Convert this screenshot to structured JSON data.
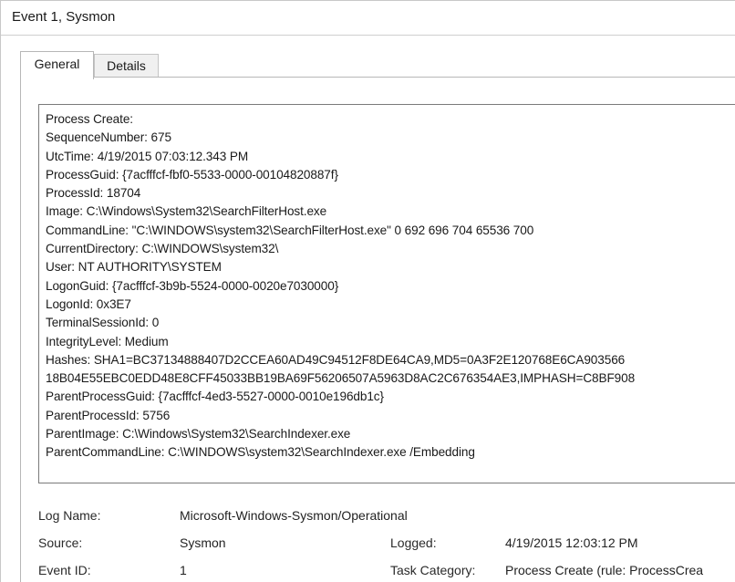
{
  "window": {
    "title": "Event 1, Sysmon"
  },
  "tabs": [
    {
      "label": "General",
      "selected": true
    },
    {
      "label": "Details",
      "selected": false
    }
  ],
  "description_lines": [
    "Process Create:",
    "SequenceNumber: 675",
    "UtcTime: 4/19/2015 07:03:12.343 PM",
    "ProcessGuid: {7acfffcf-fbf0-5533-0000-00104820887f}",
    "ProcessId: 18704",
    "Image: C:\\Windows\\System32\\SearchFilterHost.exe",
    "CommandLine: \"C:\\WINDOWS\\system32\\SearchFilterHost.exe\" 0 692 696 704 65536 700",
    "CurrentDirectory: C:\\WINDOWS\\system32\\",
    "User: NT AUTHORITY\\SYSTEM",
    "LogonGuid: {7acfffcf-3b9b-5524-0000-0020e7030000}",
    "LogonId: 0x3E7",
    "TerminalSessionId: 0",
    "IntegrityLevel: Medium",
    "Hashes: SHA1=BC37134888407D2CCEA60AD49C94512F8DE64CA9,MD5=0A3F2E120768E6CA903566",
    "18B04E55EBC0EDD48E8CFF45033BB19BA69F56206507A5963D8AC2C676354AE3,IMPHASH=C8BF908",
    "ParentProcessGuid: {7acfffcf-4ed3-5527-0000-0010e196db1c}",
    "ParentProcessId: 5756",
    "ParentImage: C:\\Windows\\System32\\SearchIndexer.exe",
    "ParentCommandLine: C:\\WINDOWS\\system32\\SearchIndexer.exe /Embedding"
  ],
  "properties": {
    "log_name": {
      "label": "Log Name:",
      "value": "Microsoft-Windows-Sysmon/Operational"
    },
    "source": {
      "label": "Source:",
      "value": "Sysmon"
    },
    "logged": {
      "label": "Logged:",
      "value": "4/19/2015 12:03:12 PM"
    },
    "event_id": {
      "label": "Event ID:",
      "value": "1"
    },
    "task_category": {
      "label": "Task Category:",
      "value": "Process Create (rule: ProcessCrea"
    }
  }
}
